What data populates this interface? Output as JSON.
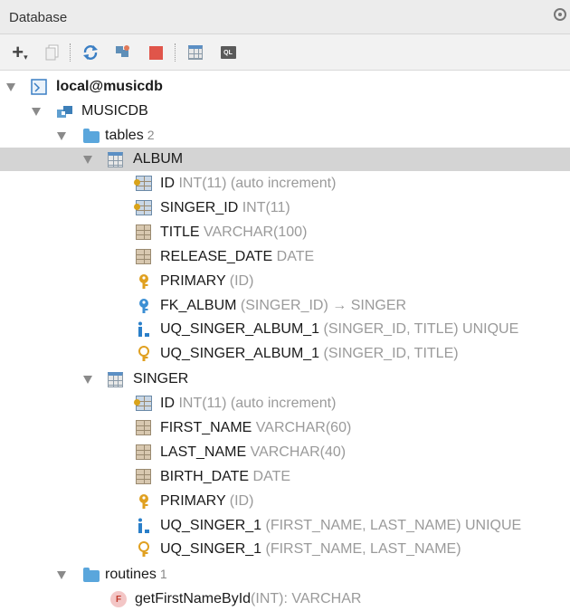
{
  "panel": {
    "title": "Database",
    "settings_icon": "gear-icon"
  },
  "toolbar": {
    "add_label": "+",
    "buttons": [
      "add-icon",
      "duplicate-icon",
      "refresh-icon",
      "synchronize-icon",
      "stop-icon",
      "table-view-icon",
      "console-icon"
    ],
    "console_label": "QL"
  },
  "tree": {
    "datasource": {
      "label": "local@musicdb"
    },
    "schema": {
      "label": "MUSICDB"
    },
    "tables_folder": {
      "label": "tables",
      "count": "2"
    },
    "album": {
      "label": "ALBUM",
      "items": [
        {
          "name": "ID",
          "meta": "INT(11) (auto increment)",
          "icon": "key-column-icon"
        },
        {
          "name": "SINGER_ID",
          "meta": "INT(11)",
          "icon": "key-column-icon"
        },
        {
          "name": "TITLE",
          "meta": "VARCHAR(100)",
          "icon": "column-icon"
        },
        {
          "name": "RELEASE_DATE",
          "meta": "DATE",
          "icon": "column-icon"
        },
        {
          "name": "PRIMARY",
          "meta": "(ID)",
          "icon": "primary-key-icon"
        },
        {
          "name": "FK_ALBUM",
          "meta": "(SINGER_ID) → SINGER",
          "icon": "foreign-key-icon"
        },
        {
          "name": "UQ_SINGER_ALBUM_1",
          "meta": "(SINGER_ID, TITLE) UNIQUE",
          "icon": "index-icon"
        },
        {
          "name": "UQ_SINGER_ALBUM_1",
          "meta": "(SINGER_ID, TITLE)",
          "icon": "unique-key-icon"
        }
      ]
    },
    "singer": {
      "label": "SINGER",
      "items": [
        {
          "name": "ID",
          "meta": "INT(11) (auto increment)",
          "icon": "key-column-icon"
        },
        {
          "name": "FIRST_NAME",
          "meta": "VARCHAR(60)",
          "icon": "column-icon"
        },
        {
          "name": "LAST_NAME",
          "meta": "VARCHAR(40)",
          "icon": "column-icon"
        },
        {
          "name": "BIRTH_DATE",
          "meta": "DATE",
          "icon": "column-icon"
        },
        {
          "name": "PRIMARY",
          "meta": "(ID)",
          "icon": "primary-key-icon"
        },
        {
          "name": "UQ_SINGER_1",
          "meta": "(FIRST_NAME, LAST_NAME) UNIQUE",
          "icon": "index-icon"
        },
        {
          "name": "UQ_SINGER_1",
          "meta": "(FIRST_NAME, LAST_NAME)",
          "icon": "unique-key-icon"
        }
      ]
    },
    "routines_folder": {
      "label": "routines",
      "count": "1"
    },
    "routine": {
      "name": "getFirstNameById",
      "meta": "(INT): VARCHAR",
      "icon_letter": "F"
    }
  }
}
